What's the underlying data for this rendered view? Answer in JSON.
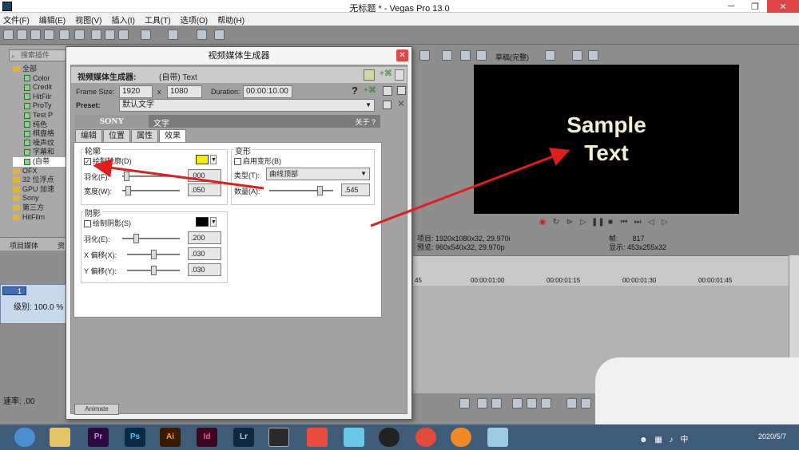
{
  "window": {
    "title": "无标题 * - Vegas Pro 13.0"
  },
  "menu": [
    "文件(F)",
    "编辑(E)",
    "视图(V)",
    "插入(I)",
    "工具(T)",
    "选项(O)",
    "帮助(H)"
  ],
  "explorer": {
    "search_placeholder": "搜索插件",
    "tree": [
      {
        "label": "全部",
        "kind": "folder"
      },
      {
        "label": "Color",
        "kind": "plugin"
      },
      {
        "label": "Credit",
        "kind": "plugin"
      },
      {
        "label": "HitFilr",
        "kind": "plugin"
      },
      {
        "label": "ProTy",
        "kind": "plugin"
      },
      {
        "label": "Test P",
        "kind": "plugin"
      },
      {
        "label": "纯色",
        "kind": "plugin"
      },
      {
        "label": "棋盘格",
        "kind": "plugin"
      },
      {
        "label": "噪声纹",
        "kind": "plugin"
      },
      {
        "label": "字幕和",
        "kind": "plugin"
      },
      {
        "label": "(自带",
        "kind": "plugin"
      },
      {
        "label": "OFX",
        "kind": "folder"
      },
      {
        "label": "32 位浮点",
        "kind": "folder"
      },
      {
        "label": "GPU 加速",
        "kind": "folder"
      },
      {
        "label": "Sony",
        "kind": "folder"
      },
      {
        "label": "第三方",
        "kind": "folder"
      },
      {
        "label": "HitFilm",
        "kind": "folder"
      }
    ],
    "tabs": [
      "项目媒体",
      "资"
    ]
  },
  "track": {
    "number": "1",
    "level": "级别: 100.0 %"
  },
  "rate": "速率: .00",
  "dialog": {
    "title": "视频媒体生成器",
    "header_label": "视频媒体生成器:",
    "header_value": "(自带) Text",
    "frame_size_label": "Frame Size:",
    "frame_w": "1920",
    "x": "x",
    "frame_h": "1080",
    "duration_label": "Duration:",
    "duration": "00:00:10.00",
    "preset_label": "Preset:",
    "preset": "默认文字",
    "sony": "SONY",
    "plugin_name": "文字",
    "about": "关于 ?",
    "tabs": [
      "编辑",
      "位置",
      "属性",
      "效果"
    ],
    "outline": {
      "title": "轮廓",
      "draw": "绘制轮廓(D)",
      "feather": "羽化(F):",
      "feather_val": ".000",
      "width": "宽度(W):",
      "width_val": ".050",
      "color": "#f5f000"
    },
    "deform": {
      "title": "变形",
      "enable": "启用变形(B)",
      "type": "类型(T):",
      "type_val": "曲线顶部",
      "amount": "数量(A):",
      "amount_val": ".545"
    },
    "shadow": {
      "title": "阴影",
      "draw": "绘制阴影(S)",
      "feather": "羽化(E):",
      "feather_val": ".200",
      "xoff": "X 偏移(X):",
      "xoff_val": ".030",
      "yoff": "Y 偏移(Y):",
      "yoff_val": ".030",
      "color": "#000000"
    },
    "animate": "Animate"
  },
  "preview": {
    "quality": "草稿(完整)",
    "line1": "Sample",
    "line2": "Text",
    "project": "项目: 1920x1080x32, 29.970i",
    "preview_res": "预览: 960x540x32, 29.970p",
    "frame_label": "帧:",
    "frame": "817",
    "display": "显示: 453x255x32"
  },
  "timeline": {
    "ticks": [
      "00:00:01:00",
      "00:00:01:15",
      "00:00:01:30",
      "00:00:01:45"
    ]
  },
  "taskbar": {
    "apps": [
      "Pr",
      "Ps",
      "Ai",
      "Id",
      "Lr"
    ],
    "time": "2020/5/7"
  }
}
